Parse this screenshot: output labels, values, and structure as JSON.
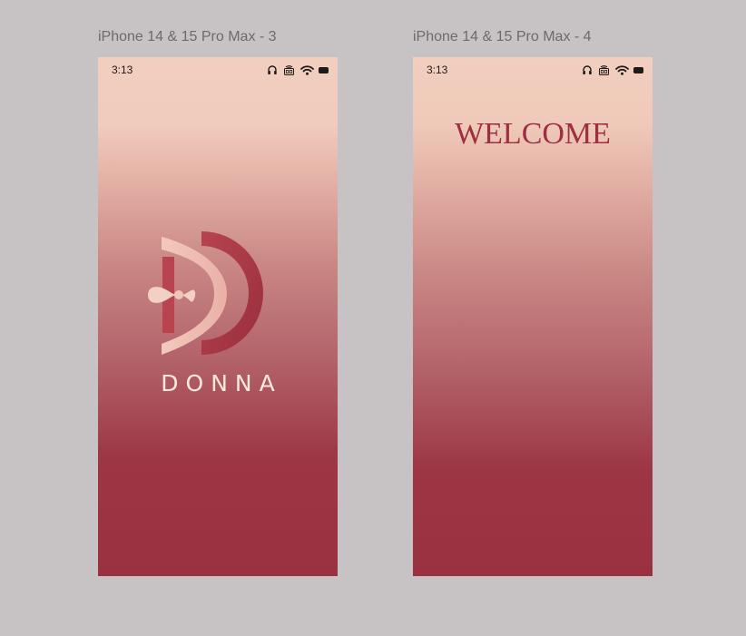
{
  "frames": [
    {
      "label": "iPhone 14 & 15 Pro Max - 3",
      "status_time": "3:13",
      "brand_name": "DONNA",
      "logo_icon": "donna-d-logo-icon"
    },
    {
      "label": "iPhone 14 & 15 Pro Max - 4",
      "status_time": "3:13",
      "welcome_text": "WELCOME"
    }
  ],
  "status_icons": [
    "headphones-icon",
    "5g-icon",
    "wifi-icon",
    "battery-icon"
  ],
  "colors": {
    "canvas_background": "#c7c2c3",
    "gradient_top": "#f1cebe",
    "gradient_bottom": "#9a3141",
    "brand_text": "#fbe8de",
    "welcome_text": "#9e2f40"
  }
}
